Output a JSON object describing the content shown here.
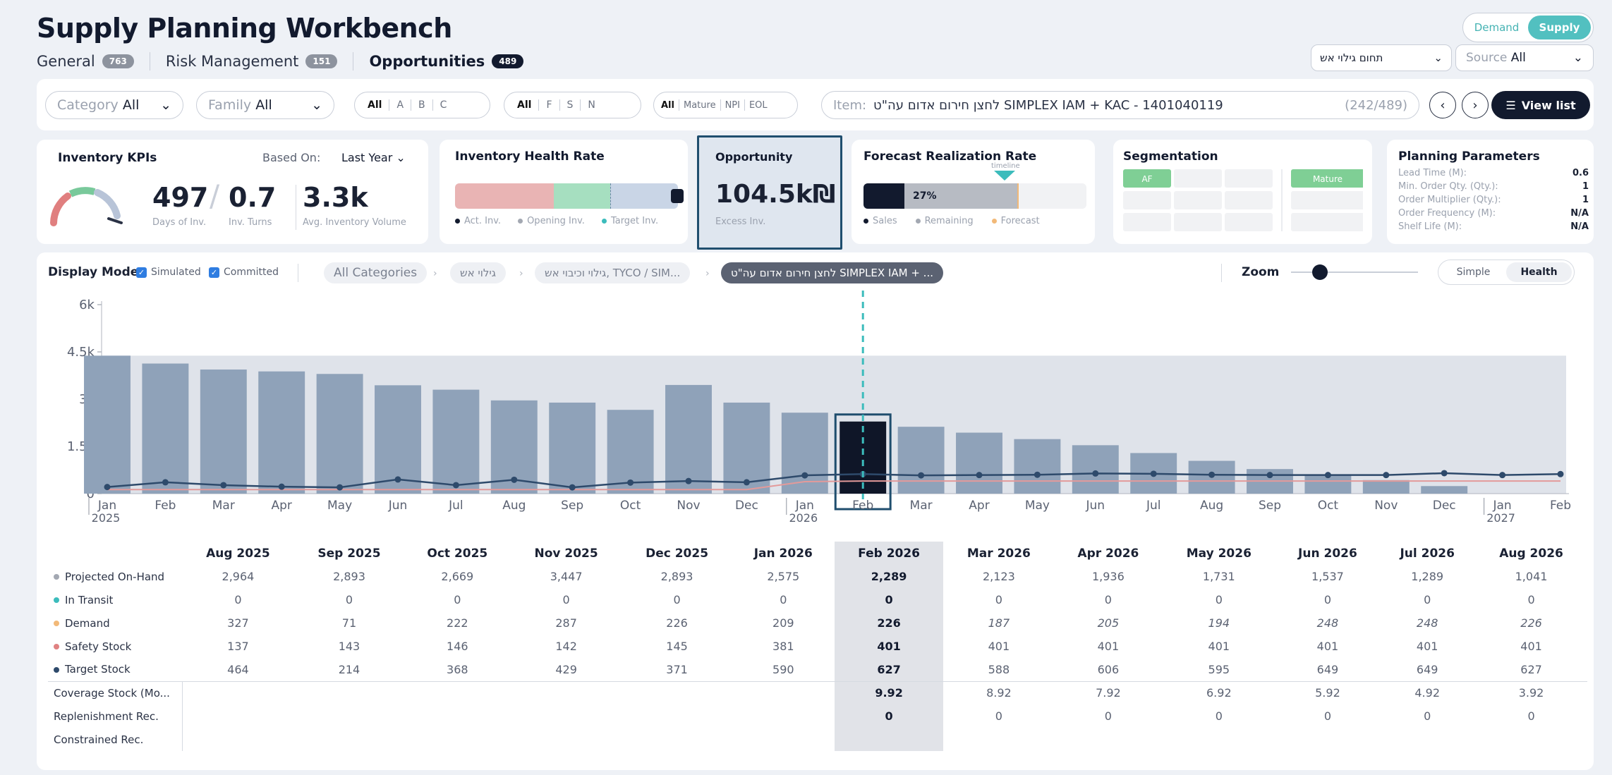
{
  "header": {
    "title": "Supply Planning Workbench",
    "tabs": [
      {
        "label": "General",
        "count": "763"
      },
      {
        "label": "Risk Management",
        "count": "151"
      },
      {
        "label": "Opportunities",
        "count": "489"
      }
    ],
    "mode_toggle": {
      "demand": "Demand",
      "supply": "Supply"
    },
    "area_select": "תחום גילוי אש",
    "source_label": "Source",
    "source_value": "All"
  },
  "filters": {
    "category_label": "Category",
    "category_value": "All",
    "family_label": "Family",
    "family_value": "All",
    "abc": [
      "All",
      "A",
      "B",
      "C"
    ],
    "fsn": [
      "All",
      "F",
      "S",
      "N"
    ],
    "lifecycle": [
      "All",
      "Mature",
      "NPI",
      "EOL"
    ],
    "item_label": "Item:",
    "item_value": "לחצן חירום אדום עה\"ט SIMPLEX IAM + KAC - 1401040119",
    "item_count": "(242/489)",
    "view_list": "View list"
  },
  "kpis": {
    "title": "Inventory KPIs",
    "based_on_label": "Based On:",
    "based_on_value": "Last Year",
    "days_value": "497",
    "days_label": "Days of Inv.",
    "turns_value": "0.7",
    "turns_label": "Inv. Turns",
    "avg_value": "3.3k",
    "avg_label": "Avg. Inventory Volume"
  },
  "health": {
    "title": "Inventory Health Rate",
    "legend": [
      "Act. Inv.",
      "Opening Inv.",
      "Target Inv."
    ]
  },
  "opportunity": {
    "title": "Opportunity",
    "value": "104.5k₪",
    "label": "Excess Inv."
  },
  "forecast": {
    "title": "Forecast Realization Rate",
    "timeline": "timeline",
    "percent": "27%",
    "legend": [
      "Sales",
      "Remaining",
      "Forecast"
    ]
  },
  "segmentation": {
    "title": "Segmentation",
    "left": "AF",
    "right": "Mature"
  },
  "params": {
    "title": "Planning Parameters",
    "rows": [
      {
        "label": "Lead Time (M):",
        "value": "0.6"
      },
      {
        "label": "Min. Order Qty. (Qty.):",
        "value": "1"
      },
      {
        "label": "Order Multiplier (Qty.):",
        "value": "1"
      },
      {
        "label": "Order Frequency (M):",
        "value": "N/A"
      },
      {
        "label": "Shelf Life (M):",
        "value": "N/A"
      }
    ]
  },
  "toolbar": {
    "display_mode": "Display Mode",
    "simulated": "Simulated",
    "committed": "Committed",
    "crumbs": [
      "All Categories",
      "גילוי אש",
      "גילוי וכיבוי אש, TYCO / SIM...",
      "לחצן חירום אדום עה\"ט SIMPLEX IAM + ..."
    ],
    "zoom": "Zoom",
    "simple": "Simple",
    "health": "Health"
  },
  "chart_data": {
    "type": "bar",
    "x": [
      "Jan 2025",
      "Feb",
      "Mar",
      "Apr",
      "May",
      "Jun",
      "Jul",
      "Aug",
      "Sep",
      "Oct",
      "Nov",
      "Dec",
      "Jan 2026",
      "Feb",
      "Mar",
      "Apr",
      "May",
      "Jun",
      "Jul",
      "Aug",
      "Sep",
      "Oct",
      "Nov",
      "Dec",
      "Jan 2027",
      "Feb"
    ],
    "x_ticks": [
      {
        "label": "Jan",
        "sub": "2025"
      },
      {
        "label": "Feb"
      },
      {
        "label": "Mar"
      },
      {
        "label": "Apr"
      },
      {
        "label": "May"
      },
      {
        "label": "Jun"
      },
      {
        "label": "Jul"
      },
      {
        "label": "Aug"
      },
      {
        "label": "Sep"
      },
      {
        "label": "Oct"
      },
      {
        "label": "Nov"
      },
      {
        "label": "Dec"
      },
      {
        "label": "Jan",
        "sub": "2026"
      },
      {
        "label": "Feb"
      },
      {
        "label": "Mar"
      },
      {
        "label": "Apr"
      },
      {
        "label": "May"
      },
      {
        "label": "Jun"
      },
      {
        "label": "Jul"
      },
      {
        "label": "Aug"
      },
      {
        "label": "Sep"
      },
      {
        "label": "Oct"
      },
      {
        "label": "Nov"
      },
      {
        "label": "Dec"
      },
      {
        "label": "Jan",
        "sub": "2027"
      },
      {
        "label": "Feb"
      }
    ],
    "series": [
      {
        "values": [
          4380,
          4130,
          3940,
          3880,
          3800,
          3440,
          3300,
          2960,
          2890,
          2660,
          3450,
          2890,
          2570,
          2289,
          2123,
          1936,
          1731,
          1537,
          1289,
          1041,
          780,
          600,
          430,
          240
        ]
      },
      {
        "values": [
          210,
          360,
          270,
          220,
          200,
          450,
          270,
          440,
          200,
          350,
          400,
          360,
          580,
          620,
          580,
          590,
          600,
          640,
          630,
          600,
          590,
          590,
          590,
          650,
          590,
          620
        ]
      },
      {
        "values": [
          130,
          130,
          130,
          130,
          130,
          130,
          130,
          130,
          130,
          130,
          130,
          130,
          380,
          400,
          400,
          400,
          400,
          400,
          400,
          400,
          400,
          400,
          400,
          400,
          400,
          400
        ]
      }
    ],
    "yticks": [
      "6k",
      "4.5k",
      "3k",
      "1.5k",
      "0"
    ],
    "ylim": [
      0,
      6000
    ],
    "highlight_index": 13
  },
  "table": {
    "columns": [
      "Aug 2025",
      "Sep 2025",
      "Oct 2025",
      "Nov 2025",
      "Dec 2025",
      "Jan 2026",
      "Feb 2026",
      "Mar 2026",
      "Apr 2026",
      "May 2026",
      "Jun 2026",
      "Jul 2026",
      "Aug 2026"
    ],
    "highlight_col": 6,
    "rows": [
      {
        "label": "Projected On-Hand",
        "dot": "#a3a8b2",
        "italic_from": 99,
        "values": [
          "2,964",
          "2,893",
          "2,669",
          "3,447",
          "2,893",
          "2,575",
          "2,289",
          "2,123",
          "1,936",
          "1,731",
          "1,537",
          "1,289",
          "1,041"
        ]
      },
      {
        "label": "In Transit",
        "dot": "#3cbcbc",
        "italic_from": 99,
        "values": [
          "0",
          "0",
          "0",
          "0",
          "0",
          "0",
          "0",
          "0",
          "0",
          "0",
          "0",
          "0",
          "0"
        ]
      },
      {
        "label": "Demand",
        "dot": "#f2b978",
        "italic_from": 6,
        "values": [
          "327",
          "71",
          "222",
          "287",
          "226",
          "209",
          "226",
          "187",
          "205",
          "194",
          "248",
          "248",
          "226"
        ]
      },
      {
        "label": "Safety Stock",
        "dot": "#e08282",
        "italic_from": 99,
        "values": [
          "137",
          "143",
          "146",
          "142",
          "145",
          "381",
          "401",
          "401",
          "401",
          "401",
          "401",
          "401",
          "401"
        ]
      },
      {
        "label": "Target Stock",
        "dot": "#2e4a6b",
        "italic_from": 99,
        "values": [
          "464",
          "214",
          "368",
          "429",
          "371",
          "590",
          "627",
          "588",
          "606",
          "595",
          "649",
          "649",
          "627"
        ]
      },
      {
        "label": "Coverage Stock (Mo...",
        "dot": "",
        "italic_from": 99,
        "values": [
          "",
          "",
          "",
          "",
          "",
          "",
          "9.92",
          "8.92",
          "7.92",
          "6.92",
          "5.92",
          "4.92",
          "3.92"
        ]
      },
      {
        "label": "Replenishment Rec.",
        "dot": "",
        "italic_from": 99,
        "values": [
          "",
          "",
          "",
          "",
          "",
          "",
          "0",
          "0",
          "0",
          "0",
          "0",
          "0",
          "0"
        ]
      },
      {
        "label": "Constrained Rec.",
        "dot": "",
        "italic_from": 99,
        "values": [
          "",
          "",
          "",
          "",
          "",
          "",
          "",
          "",
          "",
          "",
          "",
          "",
          ""
        ]
      }
    ]
  }
}
